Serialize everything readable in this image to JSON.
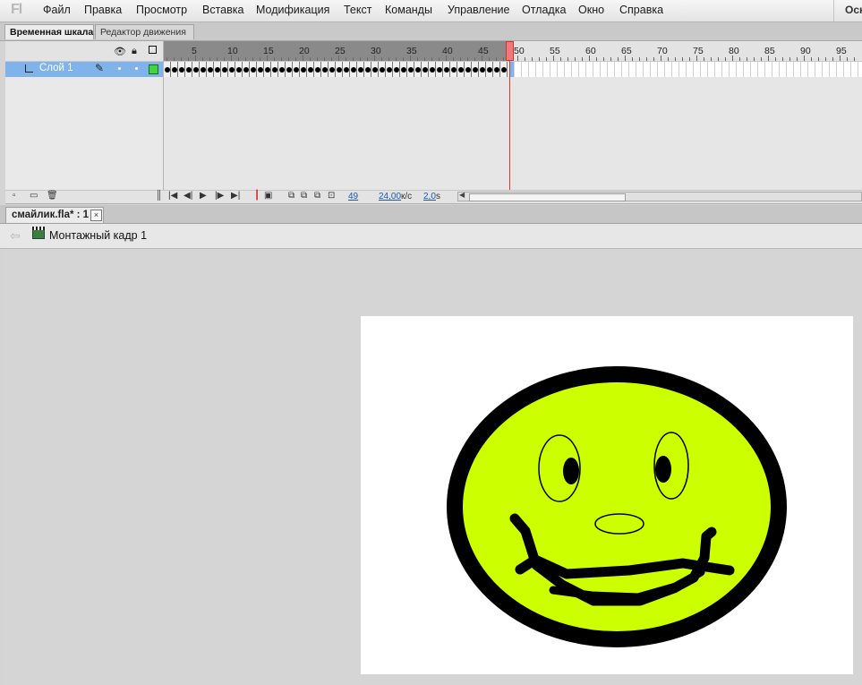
{
  "app": {
    "logo": "Fl",
    "workspace": "Осн"
  },
  "menu": [
    "Файл",
    "Правка",
    "Просмотр",
    "Вставка",
    "Модификация",
    "Текст",
    "Команды",
    "Управление",
    "Отладка",
    "Окно",
    "Справка"
  ],
  "timeline": {
    "tabs": [
      "Временная шкала",
      "Редактор движения"
    ],
    "layer": {
      "name": "Слой 1",
      "color": "#43d443"
    },
    "ruler_numbers": [
      "5",
      "10",
      "15",
      "20",
      "25",
      "30",
      "35",
      "40",
      "45",
      "50",
      "55",
      "60",
      "65",
      "70",
      "75",
      "80",
      "85",
      "90",
      "95"
    ],
    "keyframes": 48,
    "current_frame": "49",
    "fps": "24,00",
    "fps_unit": "к/с",
    "elapsed": "2,0",
    "elapsed_unit": "s"
  },
  "document": {
    "tab_label": "смайлик.fla* : 1",
    "close_glyph": "×",
    "scene": "Монтажный кадр 1"
  },
  "stage": {
    "background": "#ffffff",
    "face_fill": "#ccff00",
    "outline": "#000000"
  }
}
